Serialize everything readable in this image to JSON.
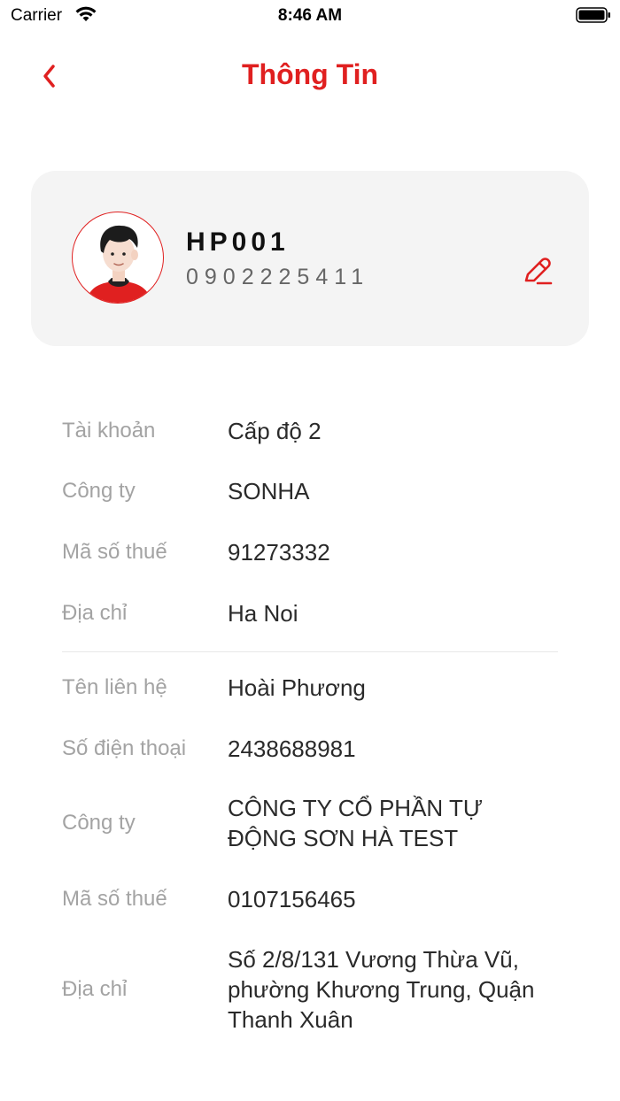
{
  "status_bar": {
    "carrier": "Carrier",
    "time": "8:46 AM"
  },
  "nav": {
    "title": "Thông Tin",
    "back_icon": "chevron-left-icon"
  },
  "profile": {
    "name": "HP001",
    "phone": "0902225411",
    "edit_icon": "pencil-icon"
  },
  "account_info": [
    {
      "label": "Tài khoản",
      "value": "Cấp độ 2"
    },
    {
      "label": "Công ty",
      "value": "SONHA"
    },
    {
      "label": "Mã số thuế",
      "value": "91273332"
    },
    {
      "label": "Địa chỉ",
      "value": "Ha Noi"
    }
  ],
  "contact_info": [
    {
      "label": "Tên liên hệ",
      "value": "Hoài Phương"
    },
    {
      "label": "Số điện thoại",
      "value": "2438688981"
    },
    {
      "label": "Công ty",
      "value": "CÔNG TY CỔ PHẦN TỰ ĐỘNG SƠN HÀ TEST"
    },
    {
      "label": "Mã số thuế",
      "value": "0107156465"
    },
    {
      "label": "Địa chỉ",
      "value": "Số 2/8/131 Vương Thừa Vũ, phường Khương Trung, Quận Thanh Xuân"
    }
  ],
  "colors": {
    "accent": "#e02020",
    "card_bg": "#f4f4f4",
    "label": "#a3a3a3",
    "value": "#2a2a2a"
  }
}
